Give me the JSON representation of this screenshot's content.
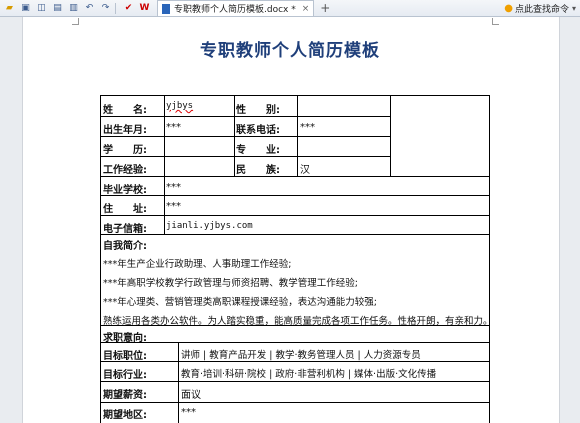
{
  "toolbar": {
    "icons": [
      "folder-open-icon",
      "save-icon",
      "save-as-icon",
      "print-icon",
      "print-preview-icon",
      "undo-icon",
      "redo-icon",
      "check-icon",
      "wps-logo-icon"
    ],
    "tab_title": "专职教师个人简历模板.docx *",
    "tab_close": "×",
    "new_tab": "+",
    "search_hint": "点此查找命令",
    "dropdown": "▾"
  },
  "document": {
    "title": "专职教师个人简历模板",
    "basic": {
      "name_label": "姓　　名:",
      "name_value": "yjbys",
      "gender_label": "性　　别:",
      "gender_value": "",
      "birth_label": "出生年月:",
      "birth_value": "***",
      "phone_label": "联系电话:",
      "phone_value": "***",
      "edu_label": "学　　历:",
      "edu_value": "",
      "major_label": "专　　业:",
      "major_value": "",
      "exp_label": "工作经验:",
      "exp_value": "",
      "ethnic_label": "民　　族:",
      "ethnic_value": "汉",
      "school_label": "毕业学校:",
      "school_value": "***",
      "address_label": "住　　址:",
      "address_value": "***",
      "email_label": "电子信箱:",
      "email_value": "jianli.yjbys.com"
    },
    "self_intro": {
      "heading": "自我简介:",
      "lines": [
        "***年生产企业行政助理、人事助理工作经验;",
        "***年高职学校教学行政管理与师资招聘、教学管理工作经验;",
        "***年心理类、营销管理类高职课程授课经验，表达沟通能力较强;",
        "熟练运用各类办公软件。为人踏实稳重，能高质量完成各项工作任务。性格开朗，有亲和力。"
      ]
    },
    "intent": {
      "heading": "求职意向:",
      "position_label": "目标职位:",
      "position_value": "讲师 | 教育产品开发 | 教学·教务管理人员 | 人力资源专员",
      "industry_label": "目标行业:",
      "industry_value": "教育·培训·科研·院校 | 政府·非营利机构 | 媒体·出版·文化传播",
      "salary_label": "期望薪资:",
      "salary_value": "面议",
      "region_label": "期望地区:",
      "region_value": "***"
    }
  }
}
